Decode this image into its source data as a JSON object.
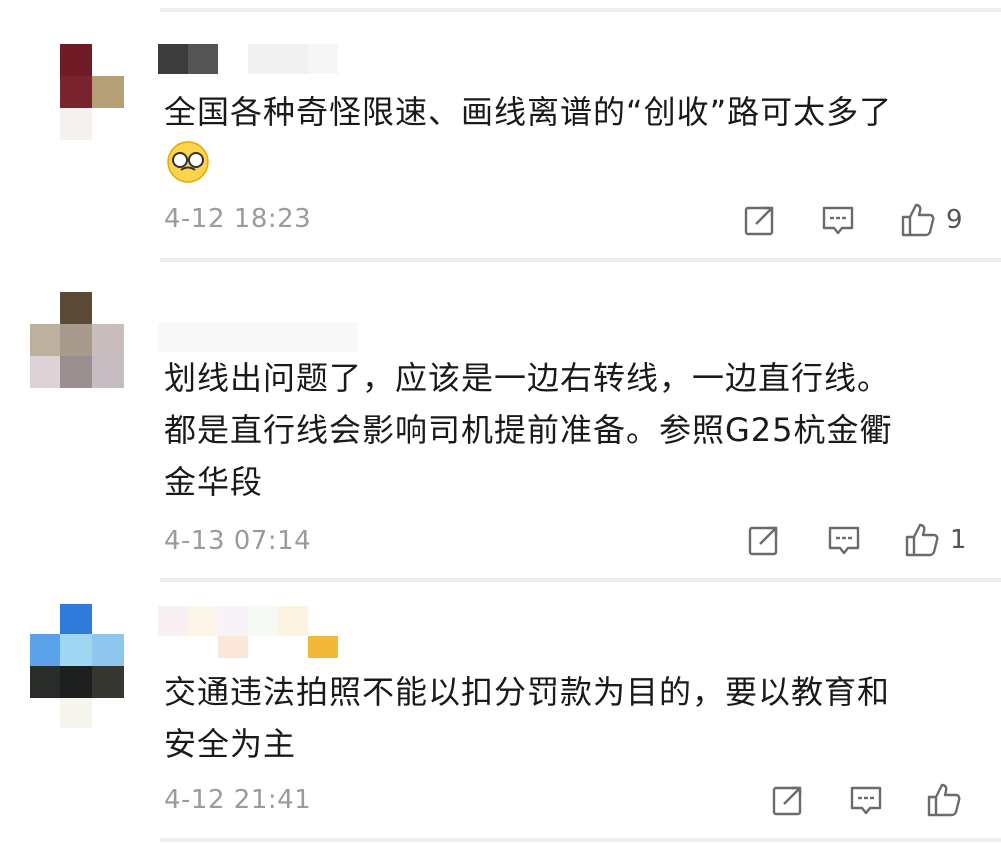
{
  "comments": [
    {
      "text": "全国各种奇怪限速、画线离谱的“创收”路可太多了",
      "emoji": "glasses-tears-emoji",
      "time": "4-12 18:23",
      "likes": "9"
    },
    {
      "text": "划线出问题了，应该是一边右转线，一边直行线。\n都是直行线会影响司机提前准备。参照G25杭金衢\n金华段",
      "time": "4-13 07:14",
      "likes": "1"
    },
    {
      "text": "交通违法拍照不能以扣分罚款为目的，要以教育和\n安全为主",
      "time": "4-12 21:41",
      "likes": ""
    }
  ],
  "icons": {
    "share": "share-icon",
    "reply": "reply-icon",
    "like": "thumbs-up-icon"
  },
  "colors": {
    "text": "#1a1a1a",
    "meta": "#9b9b9b",
    "divider": "#efefef"
  }
}
